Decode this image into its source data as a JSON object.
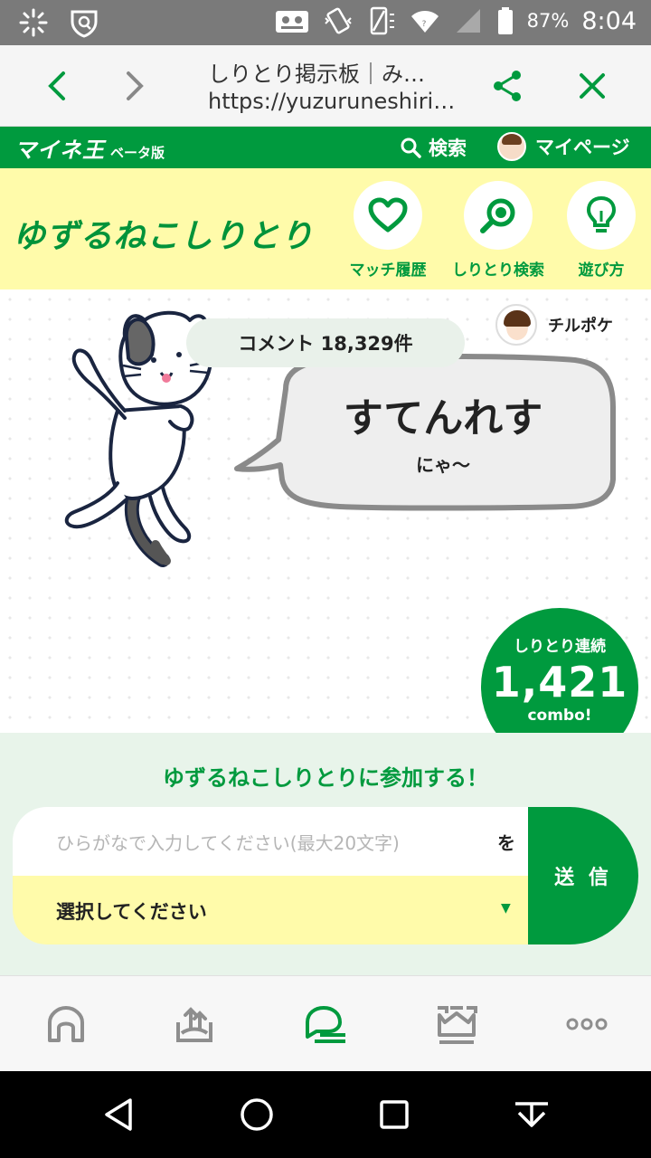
{
  "status_bar": {
    "battery": "87%",
    "time": "8:04"
  },
  "browser": {
    "page_title": "しりとり掲示板｜み…",
    "url": "https://yuzuruneshiri…"
  },
  "site_header": {
    "logo": "マイネ王",
    "beta": "ベータ版",
    "search_label": "検索",
    "mypage_label": "マイページ"
  },
  "banner": {
    "title": "ゆずるねこしりとり",
    "nav": [
      {
        "label": "マッチ履歴",
        "icon": "heart-icon"
      },
      {
        "label": "しりとり検索",
        "icon": "search-icon"
      },
      {
        "label": "遊び方",
        "icon": "lightbulb-icon"
      }
    ]
  },
  "main": {
    "comment_count": "コメント 18,329件",
    "poster_name": "チルポケ",
    "word": "すてんれす",
    "word_sub": "にゃ〜",
    "combo": {
      "label": "しりとり連続",
      "value": "1,421",
      "unit": "combo!"
    }
  },
  "join": {
    "title": "ゆずるねこしりとりに参加する！",
    "input_placeholder": "ひらがなで入力してください(最大20文字)",
    "particle": "を",
    "select_value": "選択してください",
    "submit_label": "送 信"
  },
  "bottom_nav": [
    {
      "icon": "home-icon",
      "active": false
    },
    {
      "icon": "upload-icon",
      "active": false
    },
    {
      "icon": "shiritori-icon",
      "active": true
    },
    {
      "icon": "crown-icon",
      "active": false
    },
    {
      "icon": "more-icon",
      "active": false
    }
  ],
  "colors": {
    "brand_green": "#009a3e",
    "banner_yellow": "#fffbaa",
    "join_bg": "#e8f4ea",
    "status_gray": "#7a7a7a"
  }
}
